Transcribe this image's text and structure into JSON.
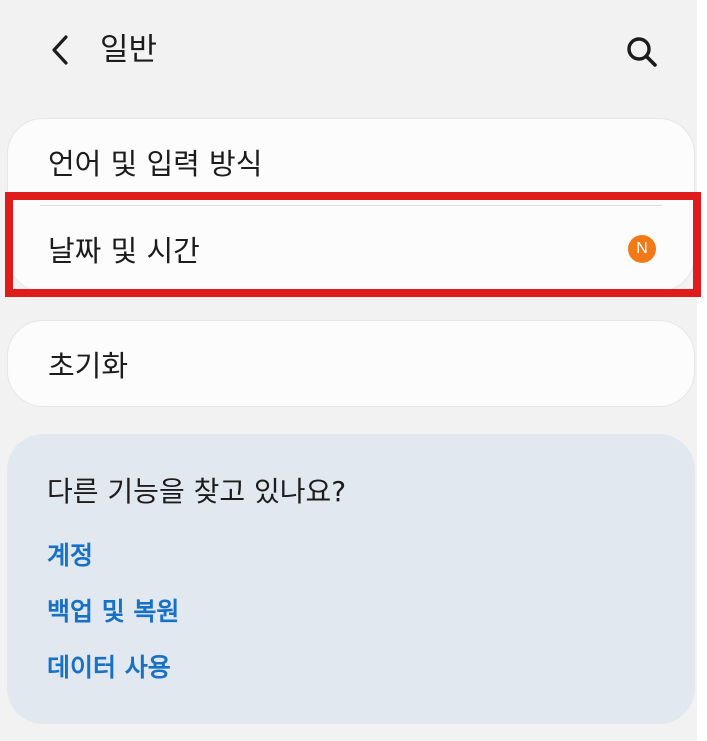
{
  "header": {
    "title": "일반",
    "back_icon": "chevron-left-icon",
    "search_icon": "search-icon"
  },
  "settings_card": {
    "items": [
      {
        "label": "언어 및 입력 방식"
      },
      {
        "label": "날짜 및 시간",
        "badge": "N"
      }
    ]
  },
  "reset_card": {
    "label": "초기화"
  },
  "suggestions": {
    "title": "다른 기능을 찾고 있나요?",
    "links": [
      {
        "label": "계정"
      },
      {
        "label": "백업 및 복원"
      },
      {
        "label": "데이터 사용"
      }
    ]
  },
  "colors": {
    "background": "#f2f2f2",
    "card": "#fcfcfc",
    "suggest_card": "#e2e8ef",
    "link": "#1771c7",
    "badge": "#f27a16",
    "highlight": "#e01b1b"
  }
}
